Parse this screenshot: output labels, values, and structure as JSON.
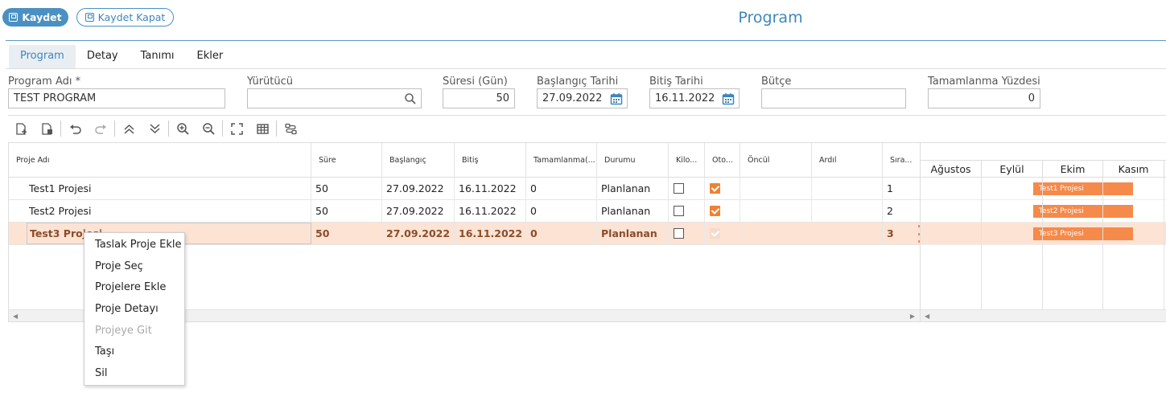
{
  "header": {
    "save_label": "Kaydet",
    "save_close_label": "Kaydet Kapat",
    "title": "Program"
  },
  "tabs": [
    {
      "label": "Program",
      "active": true
    },
    {
      "label": "Detay",
      "active": false
    },
    {
      "label": "Tanımı",
      "active": false
    },
    {
      "label": "Ekler",
      "active": false
    }
  ],
  "form": {
    "program_name": {
      "label": "Program Adı *",
      "value": "TEST PROGRAM"
    },
    "executor": {
      "label": "Yürütücü",
      "value": ""
    },
    "duration": {
      "label": "Süresi (Gün)",
      "value": "50"
    },
    "start_date": {
      "label": "Başlangıç Tarihi",
      "value": "27.09.2022"
    },
    "end_date": {
      "label": "Bitiş Tarihi",
      "value": "16.11.2022"
    },
    "budget": {
      "label": "Bütçe",
      "value": ""
    },
    "completion": {
      "label": "Tamamlanma Yüzdesi",
      "value": "0"
    }
  },
  "toolbar": {
    "icons": [
      "add-task-icon",
      "delete-task-icon",
      "undo-icon",
      "redo-icon",
      "collapse-all-icon",
      "expand-all-icon",
      "zoom-in-icon",
      "zoom-out-icon",
      "fullscreen-icon",
      "grid-icon",
      "link-icon"
    ]
  },
  "grid": {
    "columns": [
      "Proje Adı",
      "Süre",
      "Başlangıç",
      "Bitiş",
      "Tamamlanma(...",
      "Durumu",
      "Kilo...",
      "Oto...",
      "Öncül",
      "Ardıl",
      "Sıra..."
    ],
    "rows": [
      {
        "name": "Test1 Projesi",
        "duration": "50",
        "start": "27.09.2022",
        "end": "16.11.2022",
        "completion": "0",
        "status": "Planlanan",
        "milestone": false,
        "auto": true,
        "predecessor": "",
        "successor": "",
        "order": "1",
        "selected": false
      },
      {
        "name": "Test2 Projesi",
        "duration": "50",
        "start": "27.09.2022",
        "end": "16.11.2022",
        "completion": "0",
        "status": "Planlanan",
        "milestone": false,
        "auto": true,
        "predecessor": "",
        "successor": "",
        "order": "2",
        "selected": false
      },
      {
        "name": "Test3 Projesi",
        "duration": "50",
        "start": "27.09.2022",
        "end": "16.11.2022",
        "completion": "0",
        "status": "Planlanan",
        "milestone": false,
        "auto": true,
        "predecessor": "",
        "successor": "",
        "order": "3",
        "selected": true
      }
    ]
  },
  "gantt": {
    "months": [
      "Ağustos",
      "Eylül",
      "Ekim",
      "Kasım"
    ],
    "bars": [
      "Test1 Projesi",
      "Test2 Projesi",
      "Test3 Projesi"
    ],
    "bar_color": "#f58a4a"
  },
  "context_menu": {
    "items": [
      {
        "label": "Taslak Proje Ekle",
        "enabled": true
      },
      {
        "label": "Proje Seç",
        "enabled": true
      },
      {
        "label": "Projelere Ekle",
        "enabled": true
      },
      {
        "label": "Proje Detayı",
        "enabled": true
      },
      {
        "label": "Projeye Git",
        "enabled": false
      },
      {
        "label": "Taşı",
        "enabled": true
      },
      {
        "label": "Sil",
        "enabled": true
      }
    ]
  },
  "colors": {
    "accent": "#4a90c2",
    "selection": "#fde3d4",
    "checkbox": "#f08130"
  }
}
